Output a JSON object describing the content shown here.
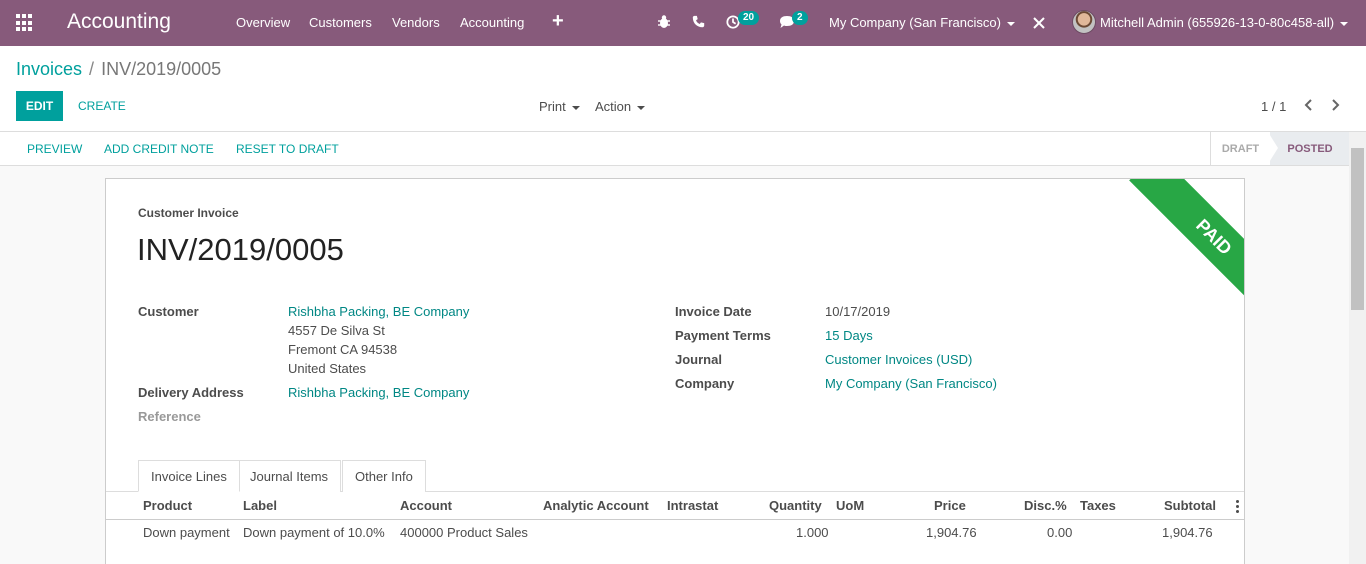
{
  "navbar": {
    "app_title": "Accounting",
    "menu": [
      "Overview",
      "Customers",
      "Vendors",
      "Accounting"
    ],
    "activity_count": "20",
    "messages_count": "2",
    "company": "My Company (San Francisco)",
    "user": "Mitchell Admin (655926-13-0-80c458-all)",
    "color": "#875a7b"
  },
  "breadcrumb": {
    "parent": "Invoices",
    "separator": "/",
    "current": "INV/2019/0005"
  },
  "control": {
    "edit_label": "EDIT",
    "create_label": "CREATE",
    "print_label": "Print",
    "action_label": "Action",
    "pager": "1 / 1"
  },
  "statusbar": {
    "preview": "PREVIEW",
    "add_credit_note": "ADD CREDIT NOTE",
    "reset_to_draft": "RESET TO DRAFT",
    "stages": [
      "DRAFT",
      "POSTED"
    ],
    "active_stage": "POSTED"
  },
  "ribbon": "PAID",
  "invoice": {
    "type": "Customer Invoice",
    "name": "INV/2019/0005",
    "customer_label": "Customer",
    "customer_name": "Rishbha Packing, BE Company",
    "address_line1": "4557 De Silva St",
    "address_line2": "Fremont CA 94538",
    "address_line3": "United States",
    "delivery_label": "Delivery Address",
    "delivery_value": "Rishbha Packing, BE Company",
    "reference_label": "Reference",
    "invoice_date_label": "Invoice Date",
    "invoice_date": "10/17/2019",
    "payment_terms_label": "Payment Terms",
    "payment_terms": "15 Days",
    "journal_label": "Journal",
    "journal": "Customer Invoices (USD)",
    "company_label": "Company",
    "company": "My Company (San Francisco)"
  },
  "tabs": [
    "Invoice Lines",
    "Journal Items",
    "Other Info"
  ],
  "lines": {
    "headers": {
      "product": "Product",
      "label": "Label",
      "account": "Account",
      "analytic": "Analytic Account",
      "intrastat": "Intrastat",
      "quantity": "Quantity",
      "uom": "UoM",
      "price": "Price",
      "disc": "Disc.%",
      "taxes": "Taxes",
      "subtotal": "Subtotal"
    },
    "rows": [
      {
        "product": "Down payment",
        "label": "Down payment of 10.0%",
        "account": "400000 Product Sales",
        "quantity": "1.000",
        "price": "1,904.76",
        "disc": "0.00",
        "subtotal": "1,904.76"
      }
    ]
  }
}
